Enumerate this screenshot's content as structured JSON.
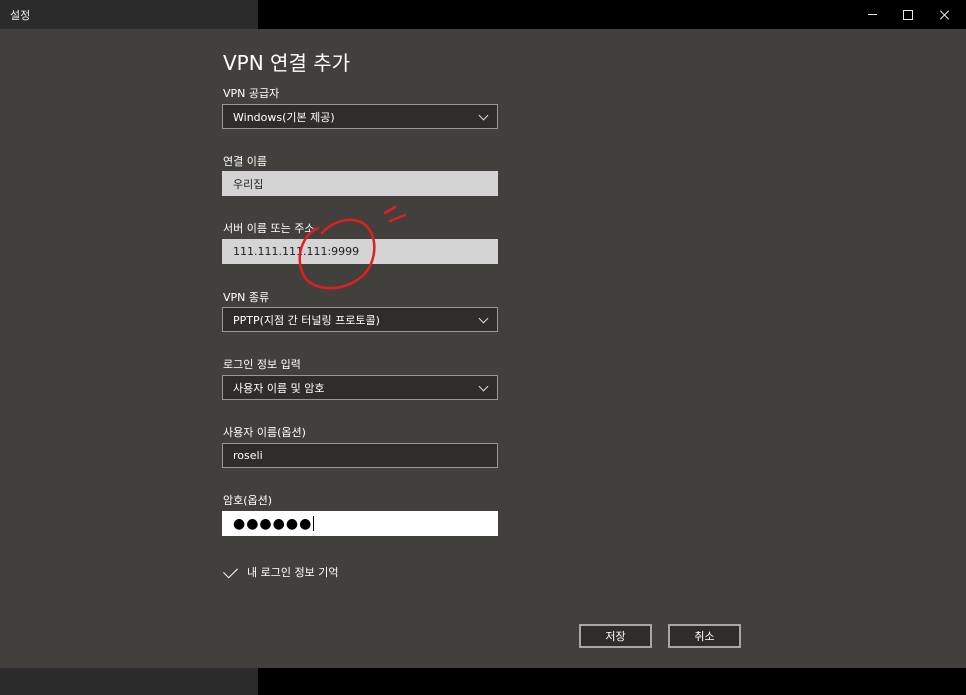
{
  "window": {
    "app_title": "설정"
  },
  "dialog": {
    "title": "VPN 연결 추가",
    "fields": {
      "provider": {
        "label": "VPN 공급자",
        "value": "Windows(기본 제공)"
      },
      "connection_name": {
        "label": "연결 이름",
        "value": "우리집"
      },
      "server": {
        "label": "서버 이름 또는 주소",
        "value": "111.111.111.111:9999"
      },
      "vpn_type": {
        "label": "VPN 종류",
        "value": "PPTP(지점 간 터널링 프로토콜)"
      },
      "sign_in_info": {
        "label": "로그인 정보 입력",
        "value": "사용자 이름 및 암호"
      },
      "username": {
        "label": "사용자 이름(옵션)",
        "value": "roseli"
      },
      "password": {
        "label": "암호(옵션)",
        "value": "●●●●●●"
      }
    },
    "remember_sign_in": {
      "label": "내 로그인 정보 기억",
      "checked": true
    },
    "buttons": {
      "save": "저장",
      "cancel": "취소"
    }
  },
  "annotation_color": "#e02020"
}
